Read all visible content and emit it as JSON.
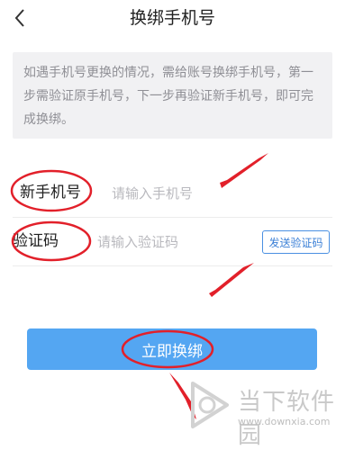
{
  "header": {
    "title": "换绑手机号",
    "back_icon": "chevron-left-icon"
  },
  "notice": {
    "text": "如遇手机号更换的情况，需给账号换绑手机号，第一步需验证原手机号，下一步再验证新手机号，即可完成换绑。"
  },
  "form": {
    "phone_label": "新手机号",
    "phone_placeholder": "请输入手机号",
    "code_label": "验证码",
    "code_placeholder": "请输入验证码",
    "send_code_label": "发送验证码"
  },
  "submit_label": "立即换绑",
  "watermark": {
    "brand": "当下软件园",
    "url": "www.downxia.com"
  },
  "colors": {
    "primary_button": "#54a6f2",
    "annotation_red": "#e2202a",
    "link_blue": "#3a7fd6"
  }
}
